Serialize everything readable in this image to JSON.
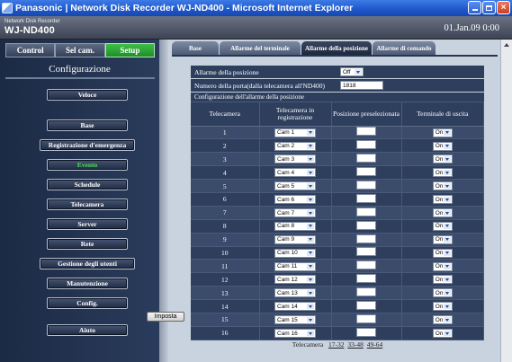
{
  "window": {
    "title": "Panasonic  |  Network Disk Recorder WJ-ND400 - Microsoft Internet Explorer"
  },
  "header": {
    "product_small": "Network Disk Recorder",
    "product_model": "WJ-ND400",
    "datetime": "01.Jan.09  0:00"
  },
  "mode_bar": [
    {
      "label": "Control",
      "active": false
    },
    {
      "label": "Sel cam.",
      "active": false
    },
    {
      "label": "Setup",
      "active": true
    }
  ],
  "sidebar": {
    "title": "Configurazione",
    "items": [
      {
        "label": "Veloce",
        "active": false
      },
      {
        "label": "Base",
        "active": false
      },
      {
        "label": "Registrazione d'emergenza",
        "active": false
      },
      {
        "label": "Evento",
        "active": true
      },
      {
        "label": "Schedule",
        "active": false
      },
      {
        "label": "Telecamera",
        "active": false
      },
      {
        "label": "Server",
        "active": false
      },
      {
        "label": "Rete",
        "active": false
      },
      {
        "label": "Gestione degli utenti",
        "active": false
      },
      {
        "label": "Manutenzione",
        "active": false
      },
      {
        "label": "Config.",
        "active": false
      },
      {
        "label": "Aiuto",
        "active": false
      }
    ]
  },
  "tabs": [
    {
      "label": "Base",
      "active": false
    },
    {
      "label": "Allarme del terminale",
      "active": false
    },
    {
      "label": "Allarme della posizione",
      "active": true
    },
    {
      "label": "Allarme di comando",
      "active": false
    }
  ],
  "form": {
    "position_alarm_label": "Allarme della posizione",
    "position_alarm_value": "Off",
    "port_label": "Numero della porta(dalla telecamera all'ND400)",
    "port_value": "1818",
    "section_label": "Configurazione dell'allarme della posizione",
    "columns": {
      "camera": "Telecamera",
      "registration_line1": "Telecamera in",
      "registration_line2": "registrazione",
      "preset": "Posizione preselezionata",
      "output": "Terminale di uscita"
    },
    "rows": [
      {
        "camera": "1",
        "registration": "Cam 1",
        "preset": "",
        "output": "On"
      },
      {
        "camera": "2",
        "registration": "Cam 2",
        "preset": "",
        "output": "On"
      },
      {
        "camera": "3",
        "registration": "Cam 3",
        "preset": "",
        "output": "On"
      },
      {
        "camera": "4",
        "registration": "Cam 4",
        "preset": "",
        "output": "On"
      },
      {
        "camera": "5",
        "registration": "Cam 5",
        "preset": "",
        "output": "On"
      },
      {
        "camera": "6",
        "registration": "Cam 6",
        "preset": "",
        "output": "On"
      },
      {
        "camera": "7",
        "registration": "Cam 7",
        "preset": "",
        "output": "On"
      },
      {
        "camera": "8",
        "registration": "Cam 8",
        "preset": "",
        "output": "On"
      },
      {
        "camera": "9",
        "registration": "Cam 9",
        "preset": "",
        "output": "On"
      },
      {
        "camera": "10",
        "registration": "Cam 10",
        "preset": "",
        "output": "On"
      },
      {
        "camera": "11",
        "registration": "Cam 11",
        "preset": "",
        "output": "On"
      },
      {
        "camera": "12",
        "registration": "Cam 12",
        "preset": "",
        "output": "On"
      },
      {
        "camera": "13",
        "registration": "Cam 13",
        "preset": "",
        "output": "On"
      },
      {
        "camera": "14",
        "registration": "Cam 14",
        "preset": "",
        "output": "On"
      },
      {
        "camera": "15",
        "registration": "Cam 15",
        "preset": "",
        "output": "On"
      },
      {
        "camera": "16",
        "registration": "Cam 16",
        "preset": "",
        "output": "On"
      }
    ]
  },
  "pager": {
    "label": "Telecamera",
    "links": [
      "17-32",
      "33-48",
      "49-64"
    ]
  },
  "submit_label": "Imposta",
  "colors": {
    "accent_active": "#1d8e2a",
    "panel_dark": "#2e3e5d",
    "panel_light": "#3a4b6c",
    "background": "#c9d3df"
  }
}
